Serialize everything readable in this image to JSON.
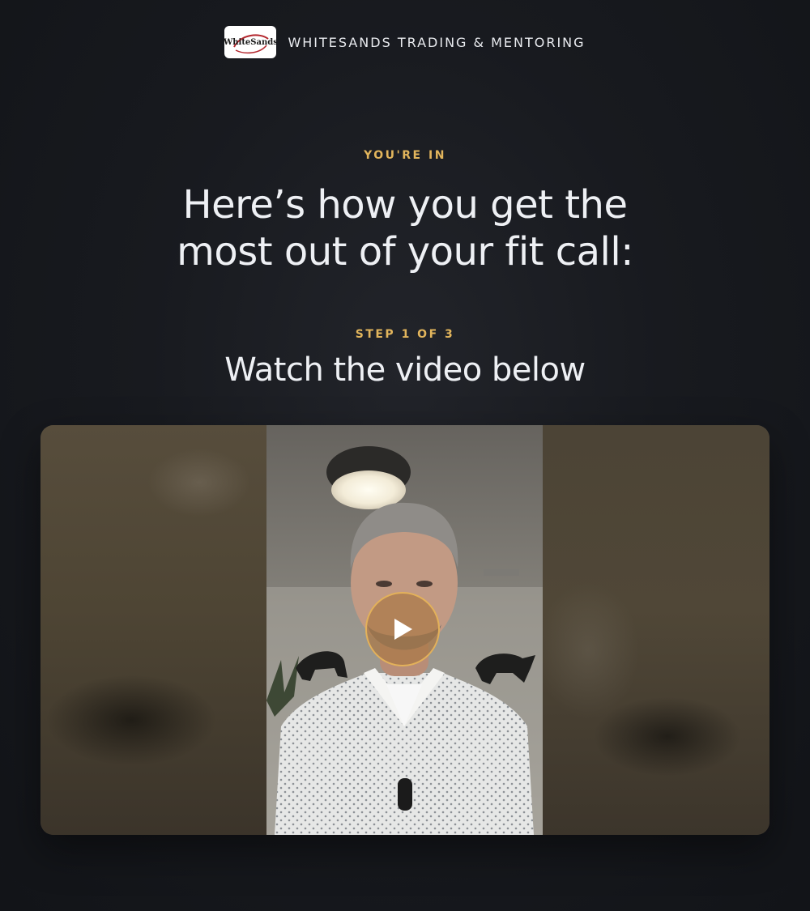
{
  "header": {
    "logo_text": "WhiteSands",
    "brand": "WHITESANDS TRADING & MENTORING"
  },
  "hero": {
    "kicker": "YOU'RE IN",
    "headline_line1": "Here’s how you get the",
    "headline_line2": "most out of your fit call:"
  },
  "step": {
    "kicker": "STEP 1 OF 3",
    "title": "Watch the video below"
  },
  "video": {
    "play_icon": "play-icon"
  },
  "colors": {
    "background": "#181a1f",
    "accent": "#e2b55c",
    "text": "#eef0f4"
  }
}
